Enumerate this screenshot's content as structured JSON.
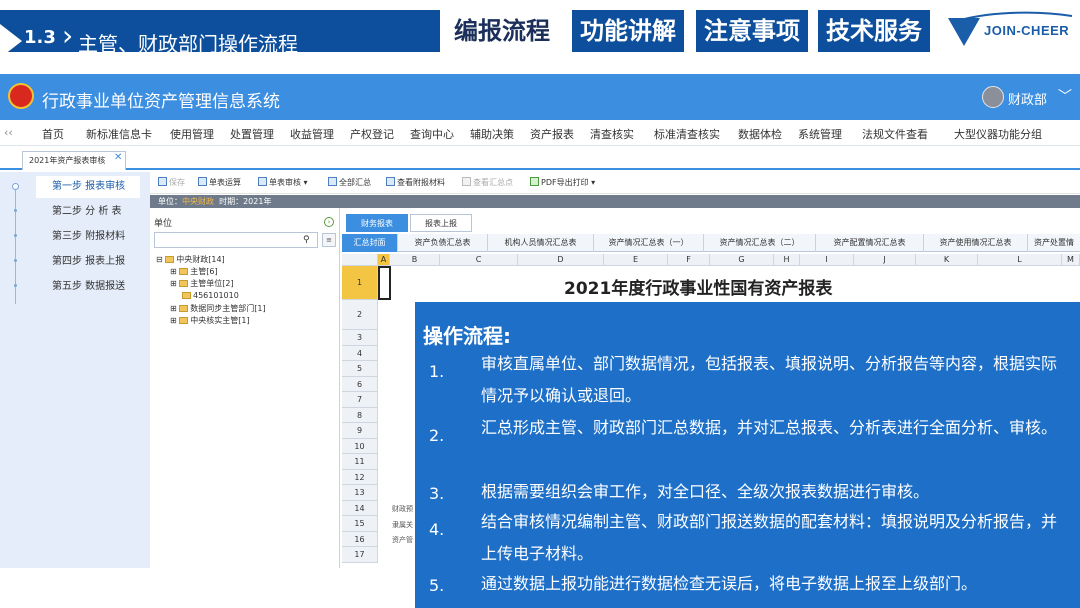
{
  "header": {
    "section_number": "1.3",
    "section_title": "主管、财政部门操作流程",
    "nav_tabs": [
      "编报流程",
      "功能讲解",
      "注意事项",
      "技术服务"
    ],
    "active_tab_index": 0,
    "logo_text": "JOIN-CHEER",
    "logo_icon": "swoosh-logo"
  },
  "app": {
    "title": "行政事业单位资产管理信息系统",
    "emblem_icon": "national-emblem",
    "user": "财政部",
    "menu": [
      "首页",
      "新标准信息卡",
      "使用管理",
      "处置管理",
      "收益管理",
      "产权登记",
      "查询中心",
      "辅助决策",
      "资产报表",
      "清查核实",
      "标准清查核实",
      "数据体检",
      "系统管理",
      "法规文件查看",
      "大型仪器功能分组"
    ],
    "doc_tab": "2021年资产报表审核"
  },
  "steps": [
    {
      "label": "第一步 报表审核",
      "active": true
    },
    {
      "label": "第二步 分 析 表",
      "active": false
    },
    {
      "label": "第三步 附报材料",
      "active": false
    },
    {
      "label": "第四步 报表上报",
      "active": false
    },
    {
      "label": "第五步 数据报送",
      "active": false
    }
  ],
  "toolbar": {
    "save": "保存",
    "single_calc": "单表运算",
    "single_audit": "单表审核",
    "full_summary": "全部汇总",
    "view_attachments": "查看附报材料",
    "view_summary_point": "查看汇总点",
    "pdf_export": "PDF导出打印"
  },
  "unit_bar": {
    "unit_label": "单位：",
    "unit_value": "中央财政",
    "period_label": "时期：",
    "period_value": "2021年"
  },
  "tree": {
    "header": "单位",
    "nodes": [
      "中央财政[14]",
      "主管[6]",
      "主管单位[2]",
      "456101010",
      "数据同步主管部门[1]",
      "中央核实主管[1]"
    ]
  },
  "sheet": {
    "tabs": [
      "财务报表",
      "报表上报"
    ],
    "subtabs": [
      "汇总封面",
      "资产负债汇总表",
      "机构人员情况汇总表",
      "资产情况汇总表（一）",
      "资产情况汇总表（二）",
      "资产配置情况汇总表",
      "资产使用情况汇总表",
      "资产处置情"
    ],
    "columns": [
      "A",
      "B",
      "C",
      "D",
      "E",
      "F",
      "G",
      "H",
      "I",
      "J",
      "K",
      "L",
      "M"
    ],
    "rows": [
      "1",
      "2",
      "3",
      "4",
      "5",
      "6",
      "7",
      "8",
      "9",
      "10",
      "11",
      "12",
      "13",
      "14",
      "15",
      "16",
      "17"
    ],
    "title": "2021年度行政事业性国有资产报表",
    "row_cells": [
      "财政预",
      "隶属关",
      "资产管"
    ]
  },
  "overlay": {
    "title": "操作流程:",
    "items": [
      {
        "num": "1.",
        "text": "审核直属单位、部门数据情况，包括报表、填报说明、分析报告等内容，根据实际情况予以确认或退回。"
      },
      {
        "num": "2.",
        "text": "汇总形成主管、财政部门汇总数据，并对汇总报表、分析表进行全面分析、审核。"
      },
      {
        "num": "3.",
        "text": "根据需要组织会审工作，对全口径、全级次报表数据进行审核。"
      },
      {
        "num": "4.",
        "text": "结合审核情况编制主管、财政部门报送数据的配套材料：填报说明及分析报告，并上传电子材料。"
      },
      {
        "num": "5.",
        "text": "通过数据上报功能进行数据检查无误后，将电子数据上报至上级部门。"
      }
    ]
  },
  "colors": {
    "brand_blue": "#0d4f9c",
    "app_blue": "#3b8ee0",
    "overlay_blue": "#1d6fc8"
  }
}
